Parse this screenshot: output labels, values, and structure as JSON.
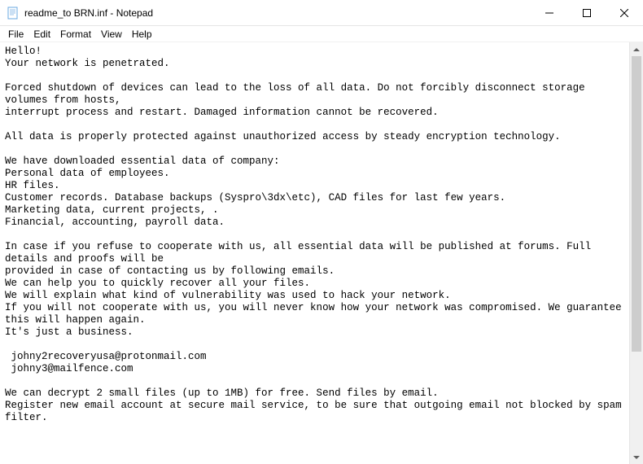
{
  "window": {
    "title": "readme_to BRN.inf - Notepad"
  },
  "menu": {
    "file": "File",
    "edit": "Edit",
    "format": "Format",
    "view": "View",
    "help": "Help"
  },
  "document": {
    "content": "Hello!\nYour network is penetrated.\n\nForced shutdown of devices can lead to the loss of all data. Do not forcibly disconnect storage volumes from hosts,\ninterrupt process and restart. Damaged information cannot be recovered.\n\nAll data is properly protected against unauthorized access by steady encryption technology.\n\nWe have downloaded essential data of company:\nPersonal data of employees.\nHR files.\nCustomer records. Database backups (Syspro\\3dx\\etc), CAD files for last few years.\nMarketing data, current projects, .\nFinancial, accounting, payroll data.\n\nIn case if you refuse to cooperate with us, all essential data will be published at forums. Full details and proofs will be\nprovided in case of contacting us by following emails.\nWe can help you to quickly recover all your files.\nWe will explain what kind of vulnerability was used to hack your network.\nIf you will not cooperate with us, you will never know how your network was compromised. We guarantee this will happen again.\nIt's just a business.\n\n johny2recoveryusa@protonmail.com\n johny3@mailfence.com\n\nWe can decrypt 2 small files (up to 1MB) for free. Send files by email.\nRegister new email account at secure mail service, to be sure that outgoing email not blocked by spam filter."
  }
}
